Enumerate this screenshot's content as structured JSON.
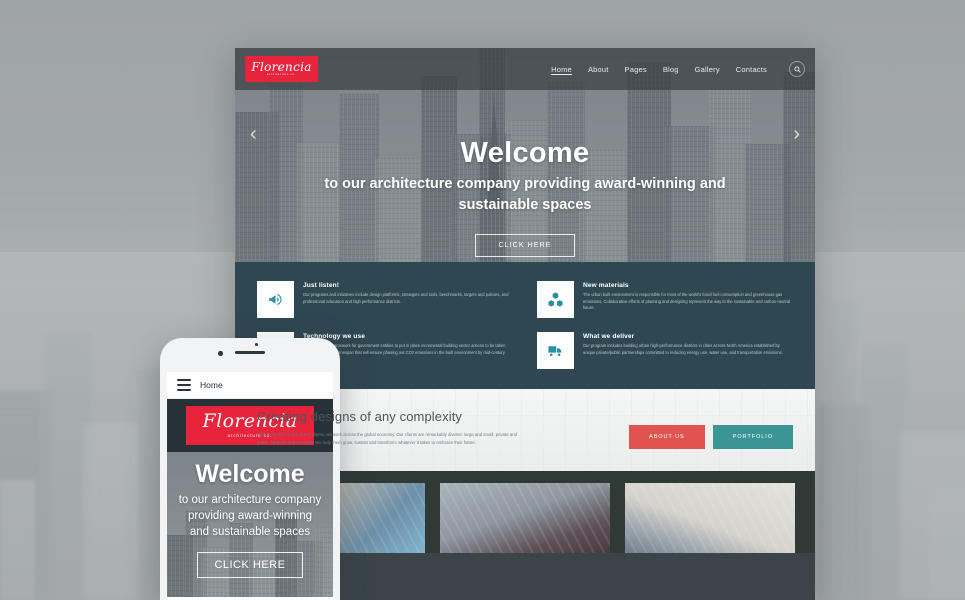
{
  "background": {
    "description": "blurred hazy city skyline photograph"
  },
  "desktop": {
    "header": {
      "logo": {
        "name": "Florencia",
        "subtitle": "architecture co."
      },
      "nav": [
        {
          "label": "Home",
          "active": true
        },
        {
          "label": "About",
          "active": false
        },
        {
          "label": "Pages",
          "active": false
        },
        {
          "label": "Blog",
          "active": false
        },
        {
          "label": "Gallery",
          "active": false
        },
        {
          "label": "Contacts",
          "active": false
        }
      ],
      "search_icon": "search-icon"
    },
    "hero": {
      "title": "Welcome",
      "subtitle": "to our architecture company providing award-winning and sustainable spaces",
      "button": "CLICK HERE",
      "prev_arrow": "‹",
      "next_arrow": "›"
    },
    "features": [
      {
        "icon": "megaphone-icon",
        "title": "Just listen!",
        "text": "Our programs and initiatives include design platforms, strategies and tools, benchmarks, targets and policies, and professional education and high performance districts."
      },
      {
        "icon": "cubes-icon",
        "title": "New materials",
        "text": "The urban built environment is responsible for most of the world's fossil fuel consumption and greenhouse gas emissions. Collaborative efforts of planning and designing represent the way to the sustainable and carbon-neutral future."
      },
      {
        "icon": "leaf-icon",
        "title": "Technology we use",
        "text": "We provide the framework for government entities to put in place incremental building sector actions to be taken over a fifteen-year timespan that will ensure phasing out CO2 emissions in the built environment by mid-century."
      },
      {
        "icon": "truck-icon",
        "title": "What we deliver",
        "text": "Our program includes building urban high-performance districts in cities across North America established by unique private/public partnerships committed to reducing energy use, water use, and transportation emissions."
      }
    ],
    "designs": {
      "title": "Creating designs of any complexity",
      "text": "With more than 2,300 active clients, we work across the global economy. Our clients are remarkably diverse: large and small, private and public, for-profit and nonprofit. We help them grow, sustain and transform: whatever it takes to embrace their future.",
      "primary_button": "ABOUT US",
      "secondary_button": "PORTFOLIO"
    },
    "gallery": {
      "thumbnails": [
        {
          "caption": "classical building facade against sky"
        },
        {
          "caption": "modern skyscraper looking up"
        },
        {
          "caption": "minimal concrete architecture detail"
        }
      ]
    }
  },
  "phone": {
    "nav": {
      "menu_icon": "hamburger-menu-icon",
      "label": "Home"
    },
    "logo": {
      "name": "Florencia",
      "subtitle": "architecture co."
    },
    "hero": {
      "title": "Welcome",
      "subtitle": "to our architecture company providing award-winning and sustainable spaces",
      "button": "CLICK HERE"
    }
  },
  "colors": {
    "brand_red": "#e8243c",
    "accent_teal": "#2b8fa3",
    "features_bg": "#2f4752",
    "button_red": "#e0534f",
    "button_teal": "#3b9595",
    "gallery_bg": "#2f3a37"
  }
}
